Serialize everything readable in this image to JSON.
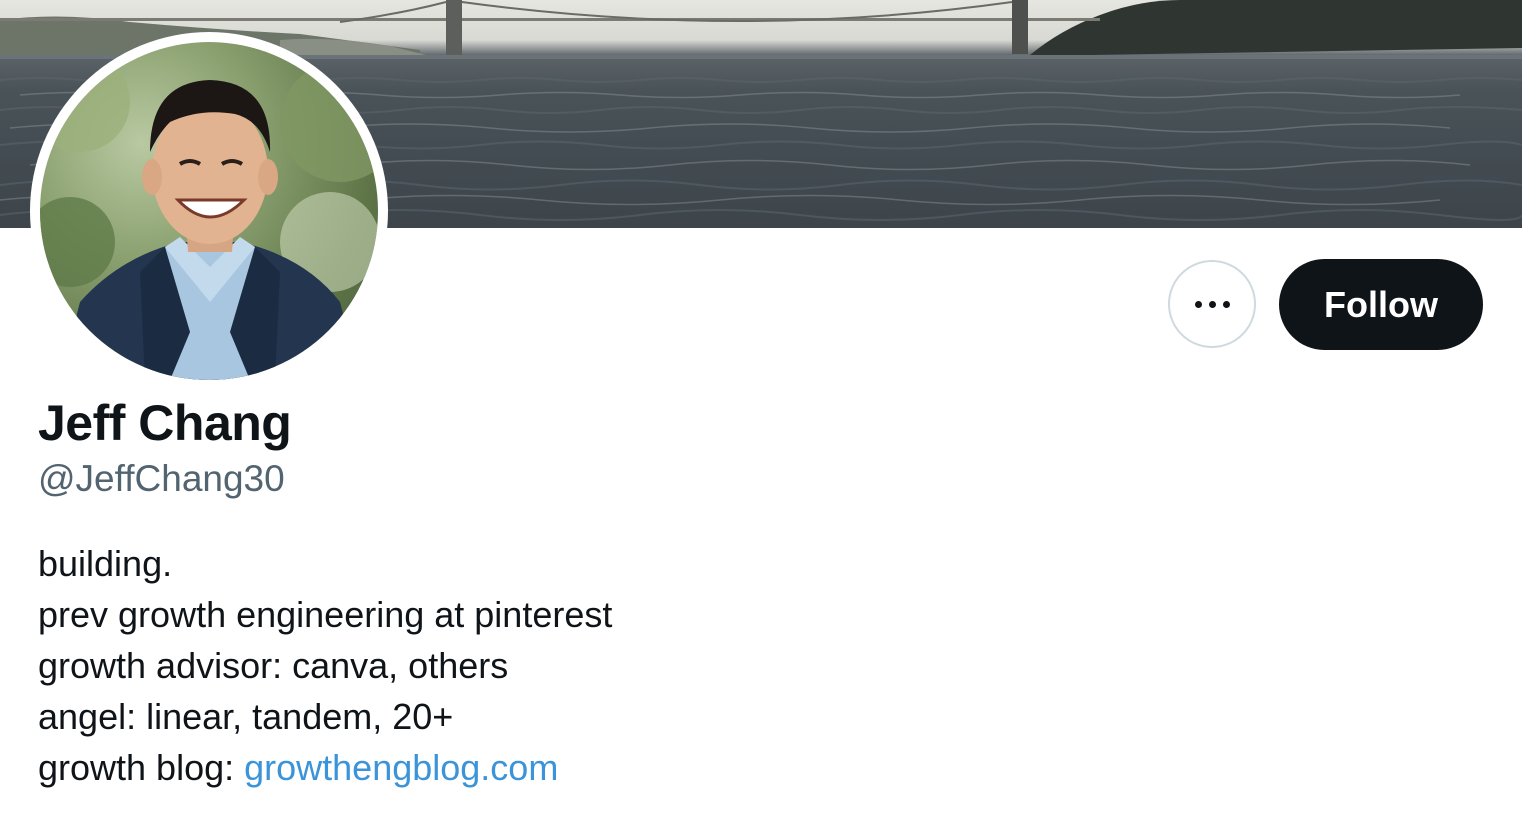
{
  "profile": {
    "name": "Jeff Chang",
    "handle": "@JeffChang30",
    "bio_lines": [
      "building.",
      "prev growth engineering at pinterest",
      "growth advisor: canva, others",
      "angel: linear, tandem, 20+"
    ],
    "blog_prefix": "growth blog: ",
    "blog_link": "growthengblog.com"
  },
  "actions": {
    "more_icon": "more-horizontal-icon",
    "follow_label": "Follow"
  },
  "colors": {
    "primary_text": "#0f1419",
    "secondary_text": "#536471",
    "link": "#3b94d9",
    "follow_bg": "#0f1419",
    "border": "#cfd9de"
  }
}
